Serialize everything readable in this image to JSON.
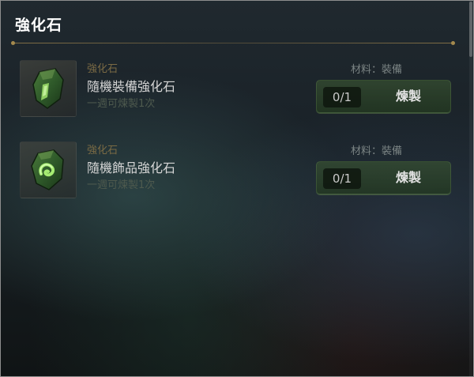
{
  "panel": {
    "title": "強化石"
  },
  "items": [
    {
      "category": "強化石",
      "name": "隨機裝備強化石",
      "limit": "一週可煉製1次",
      "material": "材料：裝備",
      "count": "0/1",
      "craft_label": "煉製",
      "icon": "green-crystal-icon"
    },
    {
      "category": "強化石",
      "name": "隨機飾品強化石",
      "limit": "一週可煉製1次",
      "material": "材料：裝備",
      "count": "0/1",
      "craft_label": "煉製",
      "icon": "green-swirl-crystal-icon"
    }
  ],
  "colors": {
    "accent_gold": "#a58a4e",
    "button_green": "#3a5432",
    "title_white": "#ffffff"
  }
}
